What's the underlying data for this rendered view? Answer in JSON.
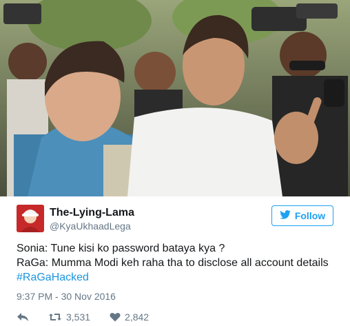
{
  "tweet": {
    "display_name": "The-Lying-Lama",
    "handle": "@KyaUkhaadLega",
    "follow_label": "Follow",
    "lines": [
      "Sonia: Tune kisi ko password bataya kya ?",
      "RaGa: Mumma Modi keh raha tha to disclose all account details"
    ],
    "hashtag": "#RaGaHacked",
    "timestamp": "9:37 PM - 30 Nov 2016",
    "retweet_count": "3,531",
    "like_count": "2,842"
  },
  "icons": {
    "follow": "twitter-bird-icon",
    "reply": "reply-icon",
    "retweet": "retweet-icon",
    "like": "heart-icon"
  },
  "colors": {
    "accent": "#1da1f2",
    "hashtag": "#1b95e0",
    "secondary_text": "#657786",
    "primary_text": "#14171a"
  }
}
